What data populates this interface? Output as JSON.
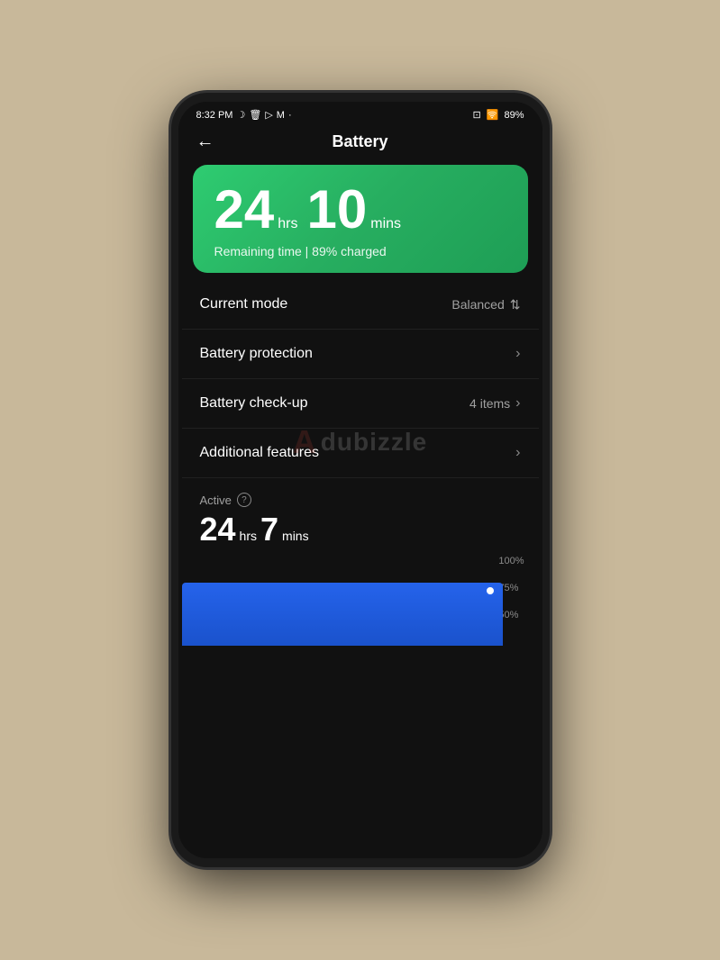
{
  "statusBar": {
    "time": "8:32 PM",
    "icons": [
      "moon",
      "delete",
      "cast",
      "email",
      "dot"
    ],
    "rightIcons": [
      "screen-record",
      "wifi",
      "battery"
    ],
    "batteryPercent": "89%"
  },
  "header": {
    "backLabel": "←",
    "title": "Battery"
  },
  "batteryCard": {
    "hours": "24",
    "hrsLabel": "hrs",
    "mins": "10",
    "minsLabel": "mins",
    "subtitle": "Remaining time | 89% charged"
  },
  "menuItems": [
    {
      "label": "Current mode",
      "value": "Balanced",
      "valueIcon": "chevron-updown",
      "hasChevron": false
    },
    {
      "label": "Battery protection",
      "value": "",
      "hasChevron": true
    },
    {
      "label": "Battery check-up",
      "value": "4 items",
      "hasChevron": true
    },
    {
      "label": "Additional features",
      "value": "",
      "hasChevron": true
    }
  ],
  "activeSection": {
    "label": "Active",
    "helpIcon": "?",
    "hours": "24",
    "hrsLabel": "hrs",
    "mins": "7",
    "minsLabel": "mins"
  },
  "chart": {
    "labels": [
      "100%",
      "75%",
      "50%"
    ]
  },
  "watermark": {
    "text": "dubizzle",
    "logoChar": "A"
  }
}
